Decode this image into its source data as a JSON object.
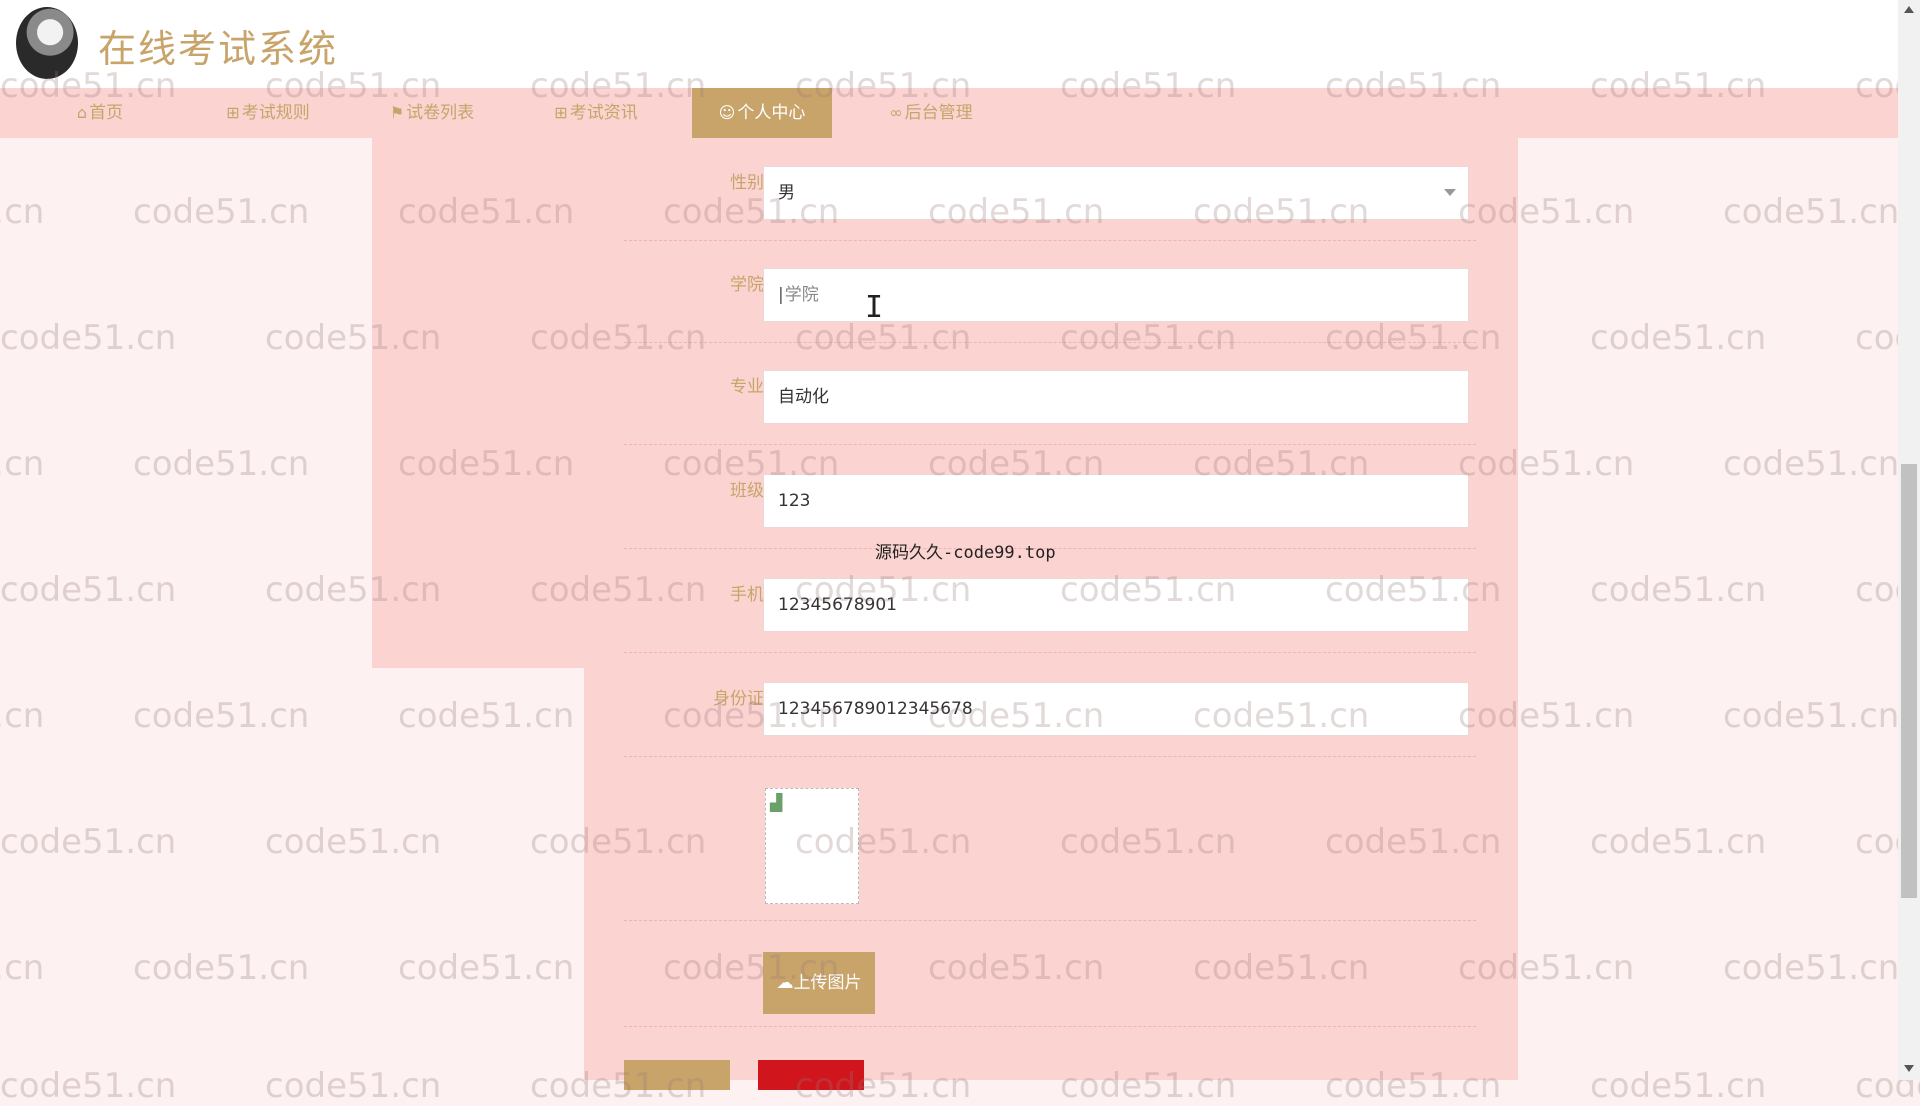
{
  "header": {
    "title": "在线考试系统"
  },
  "nav": {
    "items": [
      {
        "label": "首页",
        "icon": "home-icon",
        "glyph": "⌂"
      },
      {
        "label": "考试规则",
        "icon": "rules-icon",
        "glyph": "⊞"
      },
      {
        "label": "试卷列表",
        "icon": "flag-icon",
        "glyph": "⚑"
      },
      {
        "label": "考试资讯",
        "icon": "news-icon",
        "glyph": "⊞"
      },
      {
        "label": "个人中心",
        "icon": "user-icon",
        "glyph": "☺",
        "active": true
      },
      {
        "label": "后台管理",
        "icon": "link-icon",
        "glyph": "∞"
      }
    ]
  },
  "form": {
    "gender": {
      "label": "性别",
      "value": "男"
    },
    "college": {
      "label": "学院",
      "placeholder": "学院",
      "value": ""
    },
    "major": {
      "label": "专业",
      "value": "自动化"
    },
    "class": {
      "label": "班级",
      "value": "123"
    },
    "phone": {
      "label": "手机",
      "value": "12345678901"
    },
    "idcard": {
      "label": "身份证",
      "value": "123456789012345678"
    },
    "upload_label": "上传图片"
  },
  "center_watermark": "源码久久-code99.top",
  "watermark_text": "code51.cn",
  "colors": {
    "accent": "#c8a46a",
    "pink_panel": "#fbd4d1",
    "danger": "#d0161c"
  }
}
